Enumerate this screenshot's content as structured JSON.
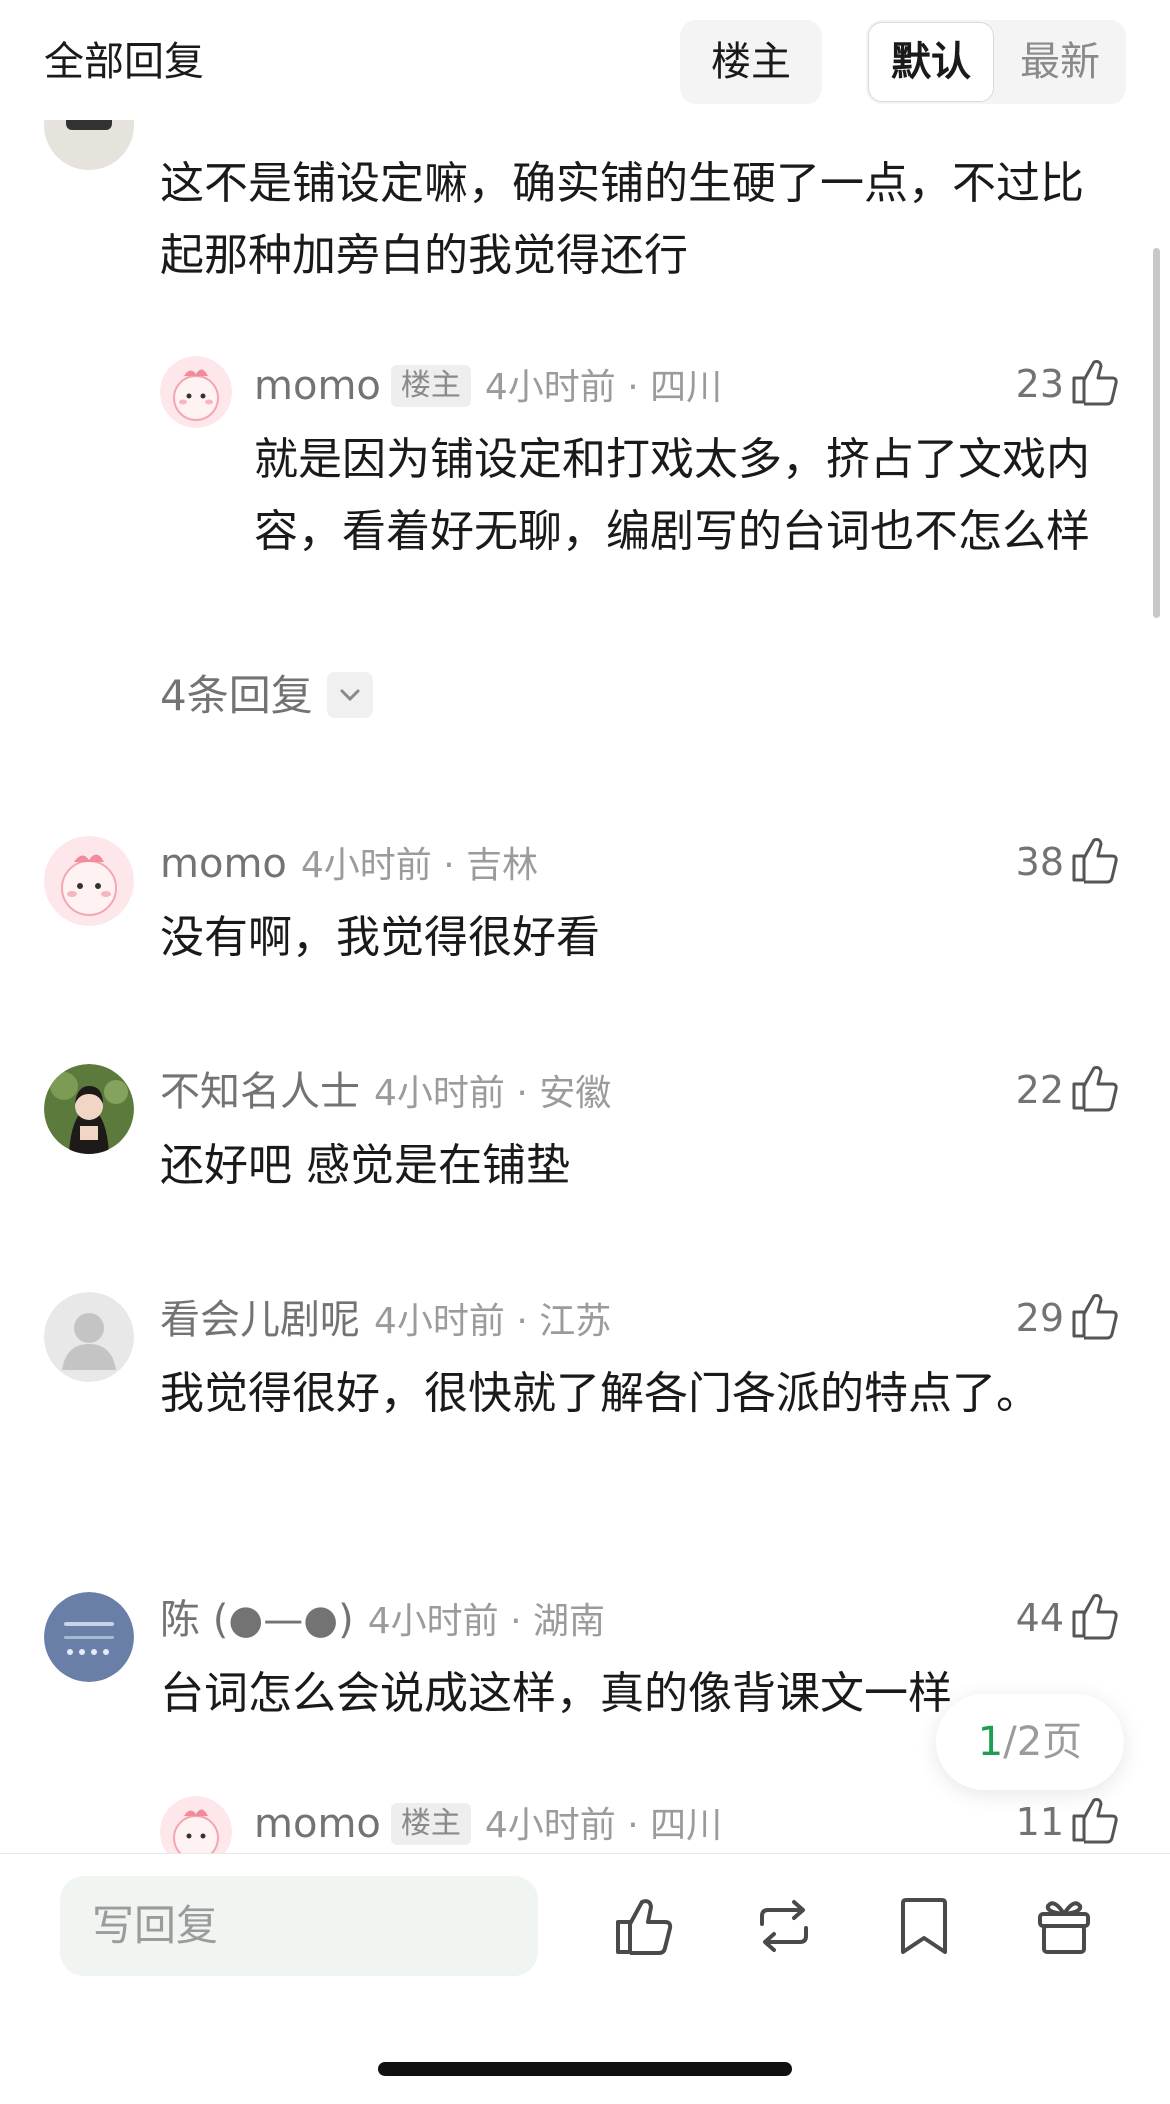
{
  "header": {
    "title": "全部回复",
    "op_filter_label": "楼主",
    "sort_default_label": "默认",
    "sort_latest_label": "最新"
  },
  "comments": [
    {
      "body": "这不是铺设定嘛，确实铺的生硬了一点，不过比起那种加旁白的我觉得还行",
      "replies": [
        {
          "username": "momo",
          "tag": "楼主",
          "time": "4小时前 · 四川",
          "likes": "23",
          "body": "就是因为铺设定和打戏太多，挤占了文戏内容，看着好无聊，编剧写的台词也不怎么样"
        }
      ],
      "more_replies": "4条回复"
    },
    {
      "username": "momo",
      "time": "4小时前 · 吉林",
      "likes": "38",
      "body": "没有啊，我觉得很好看"
    },
    {
      "username": "不知名人士",
      "time": "4小时前 · 安徽",
      "likes": "22",
      "body": "还好吧 感觉是在铺垫"
    },
    {
      "username": "看会儿剧呢",
      "time": "4小时前 · 江苏",
      "likes": "29",
      "body": "我觉得很好，很快就了解各门各派的特点了。"
    },
    {
      "username": "陈 (●—●)",
      "time": "4小时前 · 湖南",
      "likes": "44",
      "body": "台词怎么会说成这样，真的像背课文一样",
      "replies": [
        {
          "username": "momo",
          "tag": "楼主",
          "time": "4小时前 · 四川",
          "likes": "11"
        }
      ]
    }
  ],
  "pager": {
    "current": "1",
    "total_label": "/2页"
  },
  "bottom_bar": {
    "reply_placeholder": "写回复",
    "icons": [
      "like-icon",
      "repost-icon",
      "bookmark-icon",
      "gift-icon"
    ]
  },
  "colors": {
    "accent_green": "#1f9d55",
    "muted_text": "#737373"
  }
}
